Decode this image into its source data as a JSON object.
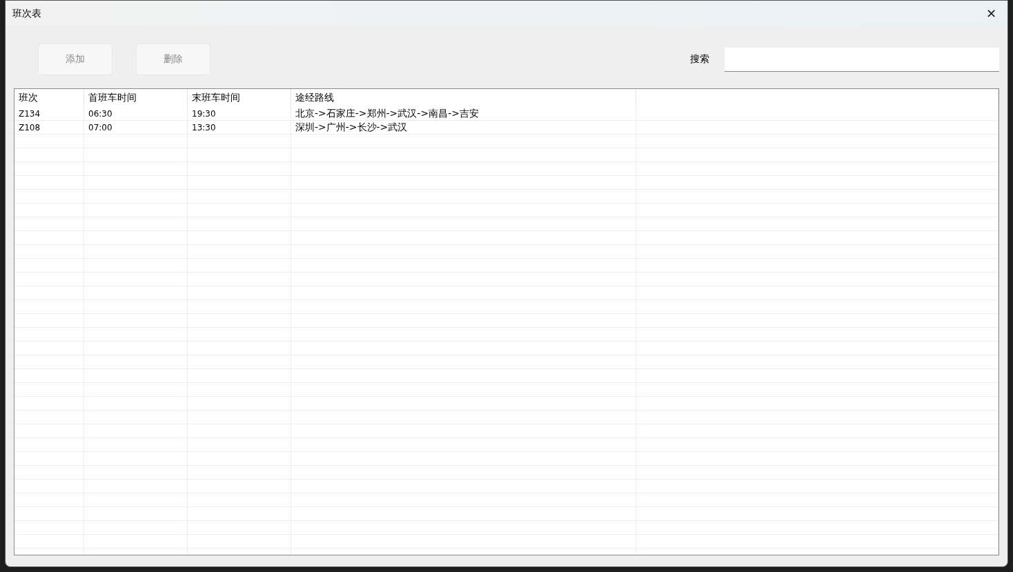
{
  "window": {
    "title": "班次表",
    "close": "✕"
  },
  "toolbar": {
    "buttons": [
      {
        "label": "添加",
        "disabled": true
      },
      {
        "label": "删除",
        "disabled": true
      }
    ],
    "search": {
      "label": "搜索"
    }
  },
  "table": {
    "columns": [
      "班次",
      "首班车时间",
      "末班车时间",
      "途经路线"
    ],
    "rows": [
      [
        "Z134",
        "06:30",
        "19:30",
        "北京->石家庄->郑州->武汉->南昌->吉安"
      ],
      [
        "Z108",
        "07:00",
        "13:30",
        "深圳->广州->长沙->武汉"
      ]
    ]
  }
}
